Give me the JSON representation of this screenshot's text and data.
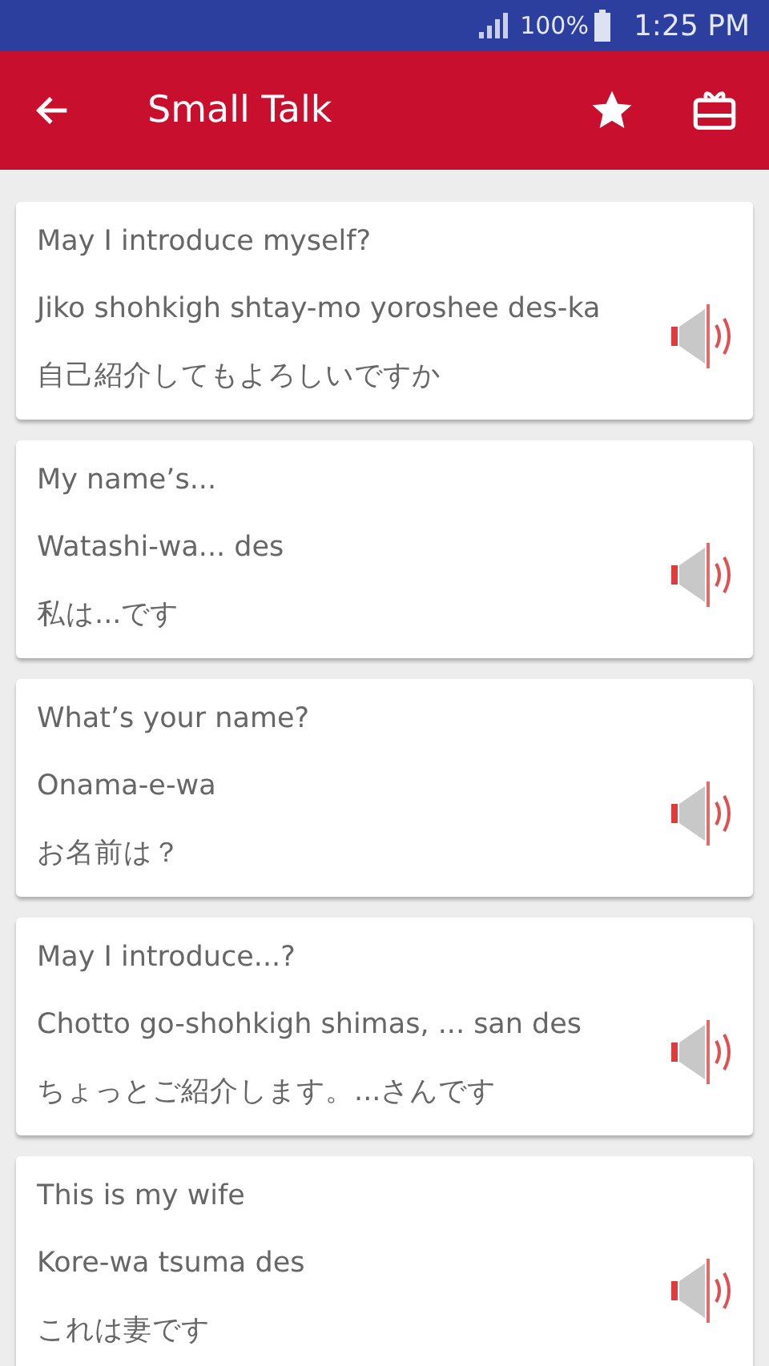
{
  "status_bar": {
    "battery": "100%",
    "time": "1:25 PM"
  },
  "app_bar": {
    "title": "Small Talk"
  },
  "phrases": [
    {
      "english": "May I introduce myself?",
      "romaji": "Jiko shohkigh shtay-mo yoroshee des-ka",
      "japanese": "自己紹介してもよろしいですか"
    },
    {
      "english": "My name’s...",
      "romaji": "Watashi-wa... des",
      "japanese": "私は...です"
    },
    {
      "english": "What’s your name?",
      "romaji": "Onama-e-wa",
      "japanese": "お名前は？"
    },
    {
      "english": "May I introduce...?",
      "romaji": "Chotto go-shohkigh shimas, ... san des",
      "japanese": "ちょっとご紹介します。...さんです"
    },
    {
      "english": "This is my wife",
      "romaji": "Kore-wa tsuma des",
      "japanese": "これは妻です"
    }
  ]
}
